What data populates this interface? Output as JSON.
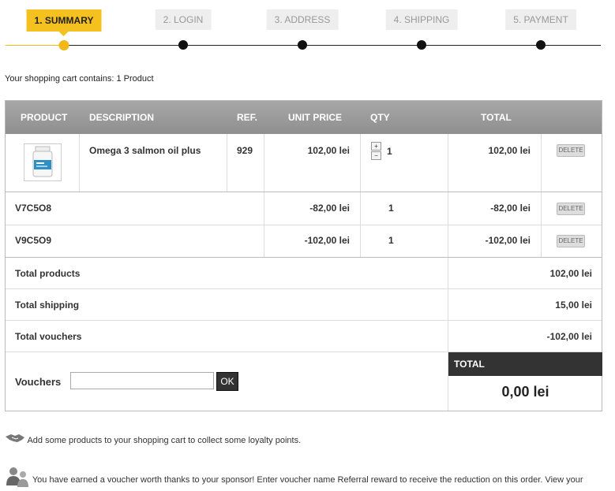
{
  "steps": [
    {
      "label": "1. SUMMARY",
      "active": true
    },
    {
      "label": "2. LOGIN",
      "active": false
    },
    {
      "label": "3. ADDRESS",
      "active": false
    },
    {
      "label": "4. SHIPPING",
      "active": false
    },
    {
      "label": "5. PAYMENT",
      "active": false
    }
  ],
  "cart_count_text": "Your shopping cart contains: 1 Product",
  "table": {
    "headers": {
      "product": "PRODUCT",
      "description": "DESCRIPTION",
      "ref": "REF.",
      "unit_price": "UNIT PRICE",
      "qty": "QTY",
      "total": "TOTAL"
    },
    "product_row": {
      "description": "Omega 3 salmon oil plus",
      "ref": "929",
      "unit_price": "102,00 lei",
      "qty": "1",
      "total": "102,00 lei",
      "delete_label": "DELETE",
      "qty_plus": "+",
      "qty_minus": "−"
    },
    "voucher_rows": [
      {
        "name": "V7C5O8",
        "unit_price": "-82,00 lei",
        "qty": "1",
        "total": "-82,00 lei",
        "delete_label": "DELETE"
      },
      {
        "name": "V9C5O9",
        "unit_price": "-102,00 lei",
        "qty": "1",
        "total": "-102,00 lei",
        "delete_label": "DELETE"
      }
    ],
    "totals": [
      {
        "label": "Total products",
        "value": "102,00 lei"
      },
      {
        "label": "Total shipping",
        "value": "15,00 lei"
      },
      {
        "label": "Total vouchers",
        "value": "-102,00 lei"
      }
    ],
    "vouchers_label": "Vouchers",
    "voucher_input_value": "",
    "ok_label": "OK",
    "grand_total_label": "TOTAL",
    "grand_total_value": "0,00 lei"
  },
  "notes": {
    "loyalty": "Add some products to your shopping cart to collect some loyalty points.",
    "referral": "You have earned a voucher worth thanks to your sponsor! Enter voucher name Referral reward to receive the reduction on this order. View your"
  },
  "colors": {
    "accent": "#f5c11f",
    "header_gray": "#999999",
    "dark": "#333333"
  }
}
